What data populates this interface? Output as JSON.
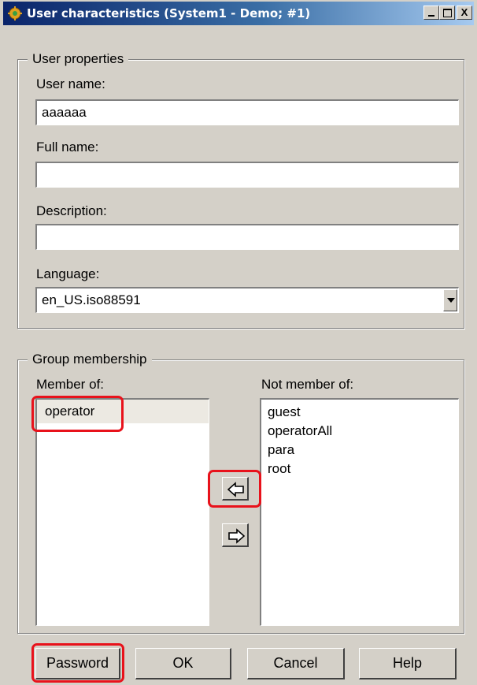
{
  "window": {
    "title": "User characteristics (System1 - Demo; #1)",
    "icons": {
      "app": "gear-icon",
      "minimize": "minimize-icon",
      "maximize": "maximize-icon",
      "close": "close-icon"
    },
    "close_glyph": "X"
  },
  "user_properties": {
    "legend": "User properties",
    "user_name_label": "User name:",
    "user_name_value": "aaaaaa",
    "full_name_label": "Full name:",
    "full_name_value": "",
    "description_label": "Description:",
    "description_value": "",
    "language_label": "Language:",
    "language_value": "en_US.iso88591"
  },
  "group_membership": {
    "legend": "Group membership",
    "member_of_label": "Member of:",
    "member_of": [
      "operator"
    ],
    "not_member_of_label": "Not member of:",
    "not_member_of": [
      "guest",
      "operatorAll",
      "para",
      "root"
    ],
    "icons": {
      "add": "arrow-left-icon",
      "remove": "arrow-right-icon"
    }
  },
  "buttons": {
    "password": "Password",
    "ok": "OK",
    "cancel": "Cancel",
    "help": "Help"
  },
  "colors": {
    "dialog_bg": "#d4d0c8",
    "title_bar": "#0a246a",
    "highlight": "#e8121b"
  }
}
